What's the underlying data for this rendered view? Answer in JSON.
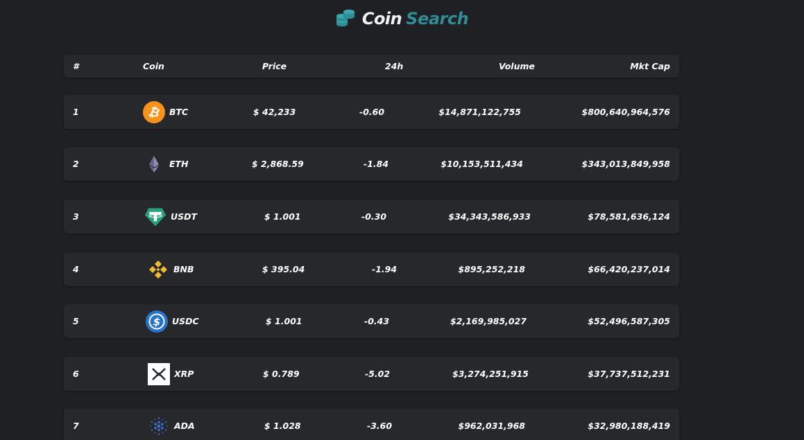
{
  "header": {
    "icon": "coins-stack-icon",
    "title_part1": "Coin",
    "title_part2": "Search",
    "accent_color": "#2e8d96"
  },
  "table": {
    "columns": {
      "rank": "#",
      "coin": "Coin",
      "price": "Price",
      "change": "24h",
      "volume": "Volume",
      "market_cap": "Mkt Cap"
    },
    "rows": [
      {
        "rank": "1",
        "icon": "bitcoin-icon",
        "symbol": "BTC",
        "price": "$ 42,233",
        "change": "-0.60",
        "volume": "$14,871,122,755",
        "market_cap": "$800,640,964,576"
      },
      {
        "rank": "2",
        "icon": "ethereum-icon",
        "symbol": "ETH",
        "price": "$ 2,868.59",
        "change": "-1.84",
        "volume": "$10,153,511,434",
        "market_cap": "$343,013,849,958"
      },
      {
        "rank": "3",
        "icon": "tether-icon",
        "symbol": "USDT",
        "price": "$ 1.001",
        "change": "-0.30",
        "volume": "$34,343,586,933",
        "market_cap": "$78,581,636,124"
      },
      {
        "rank": "4",
        "icon": "binance-icon",
        "symbol": "BNB",
        "price": "$ 395.04",
        "change": "-1.94",
        "volume": "$895,252,218",
        "market_cap": "$66,420,237,014"
      },
      {
        "rank": "5",
        "icon": "usd-coin-icon",
        "symbol": "USDC",
        "price": "$ 1.001",
        "change": "-0.43",
        "volume": "$2,169,985,027",
        "market_cap": "$52,496,587,305"
      },
      {
        "rank": "6",
        "icon": "xrp-icon",
        "symbol": "XRP",
        "price": "$ 0.789",
        "change": "-5.02",
        "volume": "$3,274,251,915",
        "market_cap": "$37,737,512,231"
      },
      {
        "rank": "7",
        "icon": "cardano-icon",
        "symbol": "ADA",
        "price": "$ 1.028",
        "change": "-3.60",
        "volume": "$962,031,968",
        "market_cap": "$32,980,188,419"
      }
    ]
  }
}
